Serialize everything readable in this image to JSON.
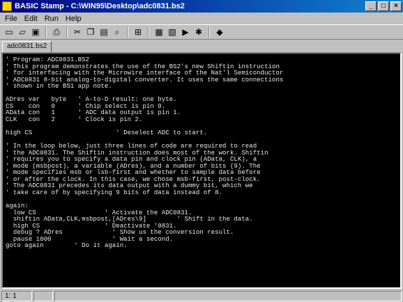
{
  "window": {
    "title": "BASIC Stamp - C:\\WIN95\\Desktop\\adc0831.bs2",
    "controls": {
      "minimize": "_",
      "maximize": "□",
      "close": "×"
    }
  },
  "menu": {
    "items": [
      "File",
      "Edit",
      "Run",
      "Help"
    ]
  },
  "toolbar": {
    "buttons": [
      {
        "name": "new-icon",
        "glyph": "▭"
      },
      {
        "name": "open-icon",
        "glyph": "▱"
      },
      {
        "name": "save-icon",
        "glyph": "▣"
      },
      {
        "name": "print-icon",
        "glyph": "⎙"
      },
      {
        "name": "cut-icon",
        "glyph": "✂"
      },
      {
        "name": "copy-icon",
        "glyph": "❐"
      },
      {
        "name": "paste-icon",
        "glyph": "▤"
      },
      {
        "name": "find-icon",
        "glyph": "⌕"
      },
      {
        "name": "preferences-icon",
        "glyph": "⊞"
      },
      {
        "name": "memory-map-icon",
        "glyph": "▦"
      },
      {
        "name": "debug-window-icon",
        "glyph": "▧"
      },
      {
        "name": "run-icon",
        "glyph": "▶"
      },
      {
        "name": "identify-icon",
        "glyph": "✱"
      },
      {
        "name": "help-icon",
        "glyph": "◆"
      }
    ]
  },
  "tabs": [
    {
      "label": "adc0831.bs2"
    }
  ],
  "editor": {
    "lines": [
      "' Program: ADC0831.BS2",
      "' This program demonstrates the use of the BS2's new Shiftin instruction",
      "' for interfacing with the Microwire interface of the Nat'l Semiconductor",
      "' ADC0831 8-bit analog-to-digital converter. It uses the same connections",
      "' shown in the BS1 app note.",
      "",
      "ADres var   byte   ' A-to-D result: one byte.",
      "CS    con   0      ' Chip select is pin 0.",
      "AData con   1      ' ADC data output is pin 1.",
      "CLK   con   2      ' Clock is pin 2.",
      "",
      "high CS                      ' Deselect ADC to start.",
      "",
      "' In the loop below, just three lines of code are required to read",
      "' the ADC0831. The Shiftin instruction does most of the work. Shiftin",
      "' requires you to specify a data pin and clock pin (AData, CLK), a",
      "' mode (msbpost), a variable (ADres), and a number of bits (9). The",
      "' mode specifies msb or lsb-first and whether to sample data before",
      "' or after the clock. In this case, we chose msb-first, post-clock.",
      "' The ADC0831 precedes its data output with a dummy bit, which we",
      "' take care of by specifying 9 bits of data instead of 8.",
      "",
      "again:",
      "  low CS                  ' Activate the ADC0831.",
      "  shiftin AData,CLK,msbpost,[ADres\\9]        ' Shift in the data.",
      "  high CS                 ' Deactivate '0831.",
      "  debug ? ADres             ' Show us the conversion result.",
      "  pause 1000                ' Wait a second.",
      "goto again        ' Do it again."
    ]
  },
  "status": {
    "position": "1: 1",
    "message": "",
    "extra": ""
  }
}
